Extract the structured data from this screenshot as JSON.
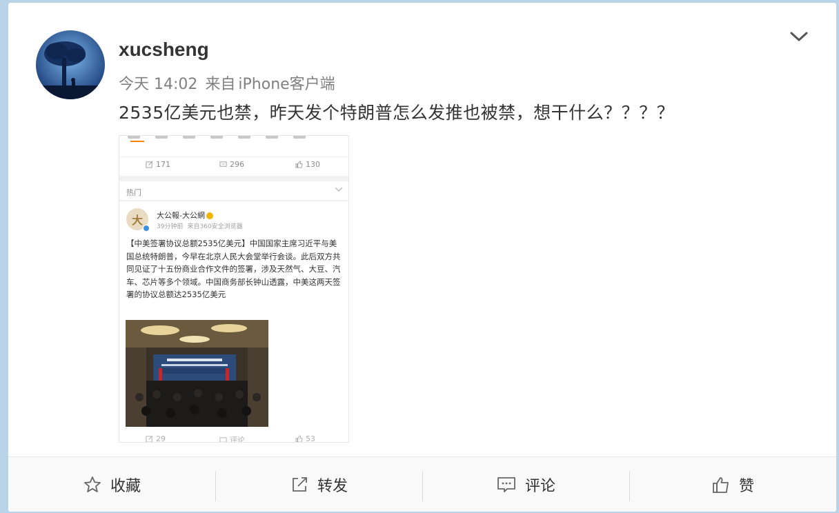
{
  "post": {
    "username": "xucsheng",
    "time": "今天 14:02",
    "source_prefix": "来自",
    "source": "iPhone客户端",
    "text": "2535亿美元也禁，昨天发个特朗普怎么发推也被禁，想干什么？？？？"
  },
  "embedded_screenshot": {
    "top_counts": {
      "repost": "171",
      "comment": "296",
      "like": "130"
    },
    "hot_label": "热门",
    "author": "大公報-大公網",
    "avatar_char": "大",
    "time": "39分钟前",
    "source": "来自360安全浏览器",
    "text": "【中美签署协议总额2535亿美元】中国国家主席习近平与美国总统特朗普，今早在北京人民大会堂举行会谈。此后双方共同见证了十五份商业合作文件的签署，涉及天然气、大豆、汽车、芯片等多个领域。中国商务部长钟山透露，中美这两天签署的协议总额达2535亿美元",
    "bottom_counts": {
      "repost": "29",
      "comment": "评论",
      "like": "53"
    }
  },
  "actions": [
    {
      "label": "收藏",
      "icon": "star-icon"
    },
    {
      "label": "转发",
      "icon": "share-icon"
    },
    {
      "label": "评论",
      "icon": "comment-icon"
    },
    {
      "label": "赞",
      "icon": "thumbs-up-icon"
    }
  ],
  "colors": {
    "background": "#b9d4e8",
    "card": "#ffffff",
    "text": "#333333",
    "meta": "#808080",
    "accent": "#ff8200"
  }
}
